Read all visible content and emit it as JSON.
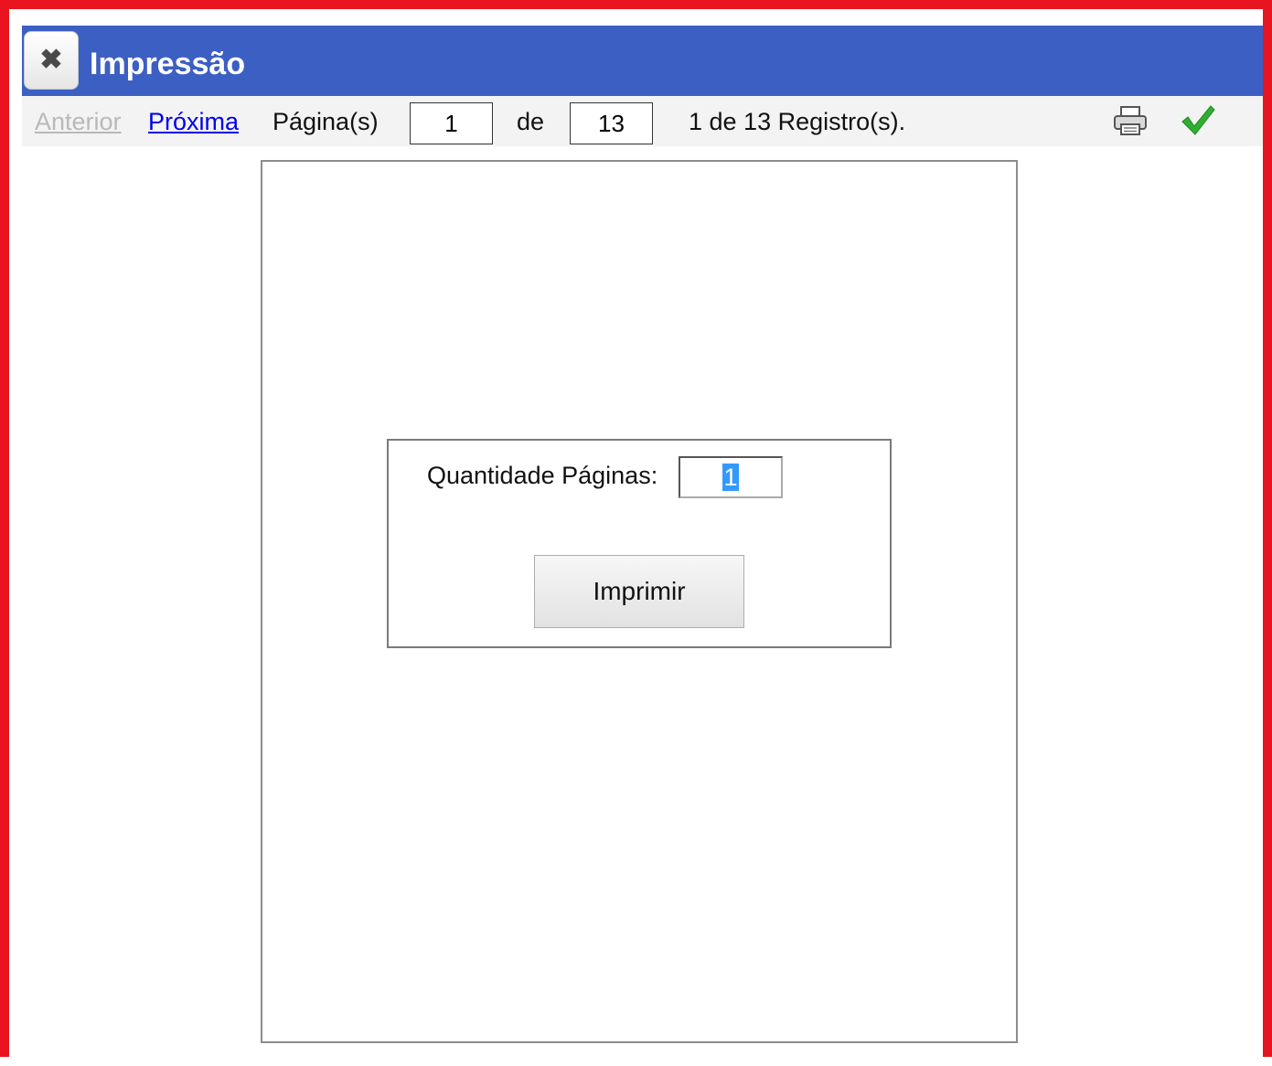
{
  "window": {
    "title": "Impressão",
    "close_icon": "close-x-icon"
  },
  "toolbar": {
    "prev_label": "Anterior",
    "next_label": "Próxima",
    "pages_label": "Página(s)",
    "current_page": "1",
    "of_label": "de",
    "total_pages": "13",
    "records_text": "1 de 13 Registro(s).",
    "print_icon": "printer-icon",
    "confirm_icon": "checkmark-icon"
  },
  "dialog": {
    "quantity_label": "Quantidade Páginas:",
    "quantity_value": "1",
    "print_button_label": "Imprimir"
  },
  "colors": {
    "frame_border": "#e8141f",
    "titlebar": "#3c5fc3",
    "link": "#0000ee",
    "link_disabled": "#b9b9b9",
    "selection": "#3399ff",
    "check": "#2fae2f"
  }
}
